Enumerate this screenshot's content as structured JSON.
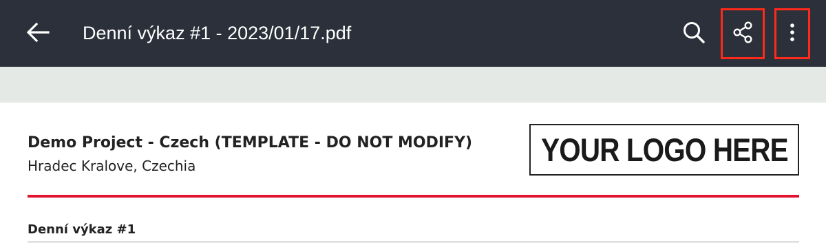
{
  "toolbar": {
    "title": "Denní výkaz #1 - 2023/01/17.pdf",
    "icons": {
      "back": "arrow-left-icon",
      "search": "search-icon",
      "share": "share-icon",
      "more": "more-vertical-icon"
    },
    "background_color": "#2b303a",
    "highlight_color": "#ff2a1a"
  },
  "document": {
    "project_name": "Demo Project - Czech (TEMPLATE - DO NOT MODIFY)",
    "project_location": "Hradec Kralove, Czechia",
    "logo_text": "YOUR LOGO HERE",
    "report_title": "Denní výkaz #1",
    "rule_color": "#e0142e"
  }
}
